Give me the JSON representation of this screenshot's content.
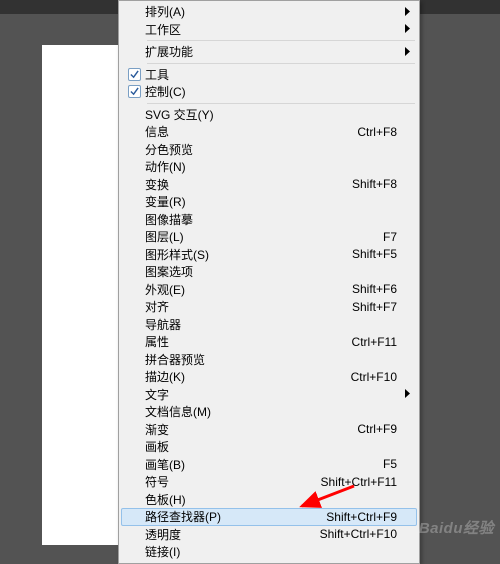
{
  "menu": {
    "groups": [
      [
        {
          "label": "排列(A)",
          "shortcut": "",
          "submenu": true,
          "checked": false
        },
        {
          "label": "工作区",
          "shortcut": "",
          "submenu": true,
          "checked": false
        }
      ],
      [
        {
          "label": "扩展功能",
          "shortcut": "",
          "submenu": true,
          "checked": false
        }
      ],
      [
        {
          "label": "工具",
          "shortcut": "",
          "submenu": false,
          "checked": true
        },
        {
          "label": "控制(C)",
          "shortcut": "",
          "submenu": false,
          "checked": true
        }
      ],
      [
        {
          "label": "SVG 交互(Y)",
          "shortcut": "",
          "submenu": false,
          "checked": false
        },
        {
          "label": "信息",
          "shortcut": "Ctrl+F8",
          "submenu": false,
          "checked": false
        },
        {
          "label": "分色预览",
          "shortcut": "",
          "submenu": false,
          "checked": false
        },
        {
          "label": "动作(N)",
          "shortcut": "",
          "submenu": false,
          "checked": false
        },
        {
          "label": "变换",
          "shortcut": "Shift+F8",
          "submenu": false,
          "checked": false
        },
        {
          "label": "变量(R)",
          "shortcut": "",
          "submenu": false,
          "checked": false
        },
        {
          "label": "图像描摹",
          "shortcut": "",
          "submenu": false,
          "checked": false
        },
        {
          "label": "图层(L)",
          "shortcut": "F7",
          "submenu": false,
          "checked": false
        },
        {
          "label": "图形样式(S)",
          "shortcut": "Shift+F5",
          "submenu": false,
          "checked": false
        },
        {
          "label": "图案选项",
          "shortcut": "",
          "submenu": false,
          "checked": false
        },
        {
          "label": "外观(E)",
          "shortcut": "Shift+F6",
          "submenu": false,
          "checked": false
        },
        {
          "label": "对齐",
          "shortcut": "Shift+F7",
          "submenu": false,
          "checked": false
        },
        {
          "label": "导航器",
          "shortcut": "",
          "submenu": false,
          "checked": false
        },
        {
          "label": "属性",
          "shortcut": "Ctrl+F11",
          "submenu": false,
          "checked": false
        },
        {
          "label": "拼合器预览",
          "shortcut": "",
          "submenu": false,
          "checked": false
        },
        {
          "label": "描边(K)",
          "shortcut": "Ctrl+F10",
          "submenu": false,
          "checked": false
        },
        {
          "label": "文字",
          "shortcut": "",
          "submenu": true,
          "checked": false
        },
        {
          "label": "文档信息(M)",
          "shortcut": "",
          "submenu": false,
          "checked": false
        },
        {
          "label": "渐变",
          "shortcut": "Ctrl+F9",
          "submenu": false,
          "checked": false
        },
        {
          "label": "画板",
          "shortcut": "",
          "submenu": false,
          "checked": false
        },
        {
          "label": "画笔(B)",
          "shortcut": "F5",
          "submenu": false,
          "checked": false
        },
        {
          "label": "符号",
          "shortcut": "Shift+Ctrl+F11",
          "submenu": false,
          "checked": false
        },
        {
          "label": "色板(H)",
          "shortcut": "",
          "submenu": false,
          "checked": false
        },
        {
          "label": "路径查找器(P)",
          "shortcut": "Shift+Ctrl+F9",
          "submenu": false,
          "checked": false,
          "highlight": true
        },
        {
          "label": "透明度",
          "shortcut": "Shift+Ctrl+F10",
          "submenu": false,
          "checked": false
        },
        {
          "label": "链接(I)",
          "shortcut": "",
          "submenu": false,
          "checked": false
        }
      ]
    ]
  },
  "watermark": {
    "main": "Bai͏d͏u经验",
    "sub": ""
  }
}
